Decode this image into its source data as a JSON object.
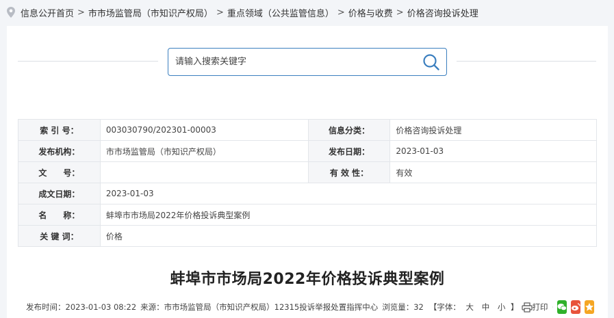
{
  "breadcrumb": {
    "items": [
      "信息公开首页",
      "市市场监管局（市知识产权局）",
      "重点领域（公共监管信息）",
      "价格与收费",
      "价格咨询投诉处理"
    ],
    "separator": ">"
  },
  "search": {
    "placeholder": "请输入搜索关键字"
  },
  "meta": {
    "index_label": "索 引 号：",
    "index_value": "003030790/202301-00003",
    "category_label": "信息分类：",
    "category_value": "价格咨询投诉处理",
    "publisher_label": "发布机构：",
    "publisher_value": "市市场监管局（市知识产权局）",
    "pubdate_label": "发布日期：",
    "pubdate_value": "2023-01-03",
    "docno_label": "文　　号：",
    "docno_value": "",
    "validity_label": "有 效 性：",
    "validity_value": "有效",
    "created_label": "成文日期：",
    "created_value": "2023-01-03",
    "name_label": "名　　称：",
    "name_value": "蚌埠市市场局2022年价格投诉典型案例",
    "keywords_label": "关 键 词：",
    "keywords_value": "价格"
  },
  "article": {
    "title": "蚌埠市市场局2022年价格投诉典型案例",
    "publish_time_label": "发布时间：",
    "publish_time": "2023-01-03 08:22",
    "source_label": "来源：",
    "source": "市市场监管局（市知识产权局）12315投诉举报处置指挥中心",
    "views_label": "浏览量：",
    "views": "32",
    "font_label": "【字体：",
    "font_large": "大",
    "font_medium": "中",
    "font_small": "小",
    "font_close": "】",
    "print_label": "打印"
  },
  "colors": {
    "search_border": "#3b7fbf",
    "wechat": "#2fb12a",
    "weibo": "#e8533b",
    "favorite": "#f5a623"
  }
}
